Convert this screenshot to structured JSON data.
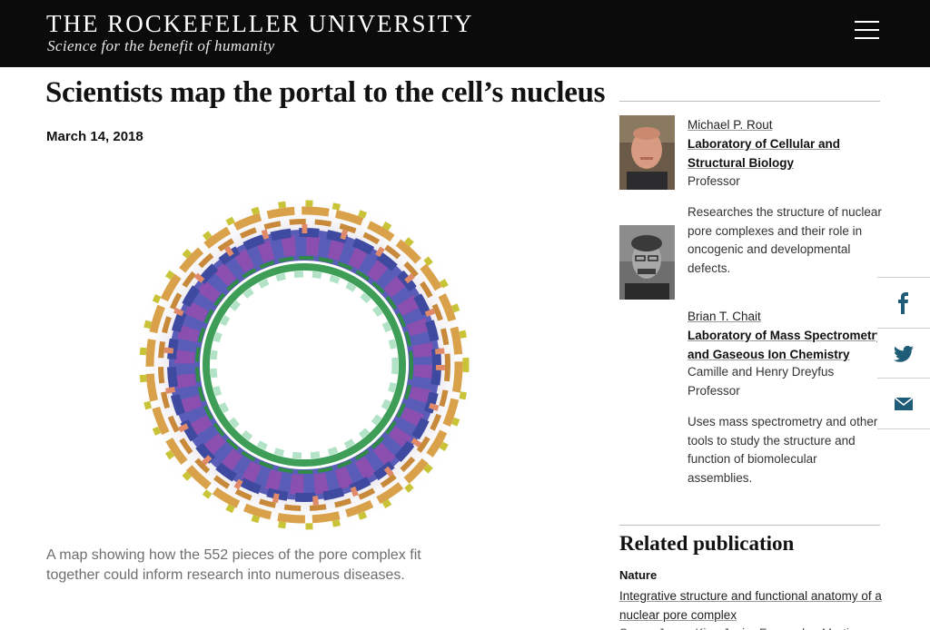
{
  "header": {
    "title": "THE ROCKEFELLER UNIVERSITY",
    "tagline": "Science for the benefit of humanity",
    "menu_icon": "hamburger-menu-icon"
  },
  "article": {
    "headline": "Scientists map the portal to the cell’s nucleus",
    "date": "March 14, 2018",
    "caption": "A map showing how the 552 pieces of the pore complex fit together could inform research into numerous diseases."
  },
  "people": [
    {
      "name": "Michael P. Rout",
      "lab": "Laboratory of Cellular and Structural Biology",
      "title": "Professor",
      "description": "Researches the structure of nuclear pore complexes and their role in oncogenic and developmental defects."
    },
    {
      "name": "Brian T. Chait",
      "lab": "Laboratory of Mass Spectrometry and Gaseous Ion Chemistry",
      "title": "Camille and Henry Dreyfus Professor",
      "description": "Uses mass spectrometry and other tools to study the structure and function of biomolecular assemblies."
    }
  ],
  "related": {
    "heading": "Related publication",
    "journal": "Nature",
    "title": "Integrative structure and functional anatomy of a nuclear pore complex",
    "authors": "Seung Joong Kim, Javier Fernandez-Martinez"
  },
  "share": {
    "color": "#1f5c77",
    "icons": [
      "facebook-icon",
      "twitter-icon",
      "email-icon"
    ]
  },
  "colors": {
    "header_bg": "#0b0b0b",
    "caption_text": "#6e6e6e",
    "rule": "#bdbdbd"
  }
}
